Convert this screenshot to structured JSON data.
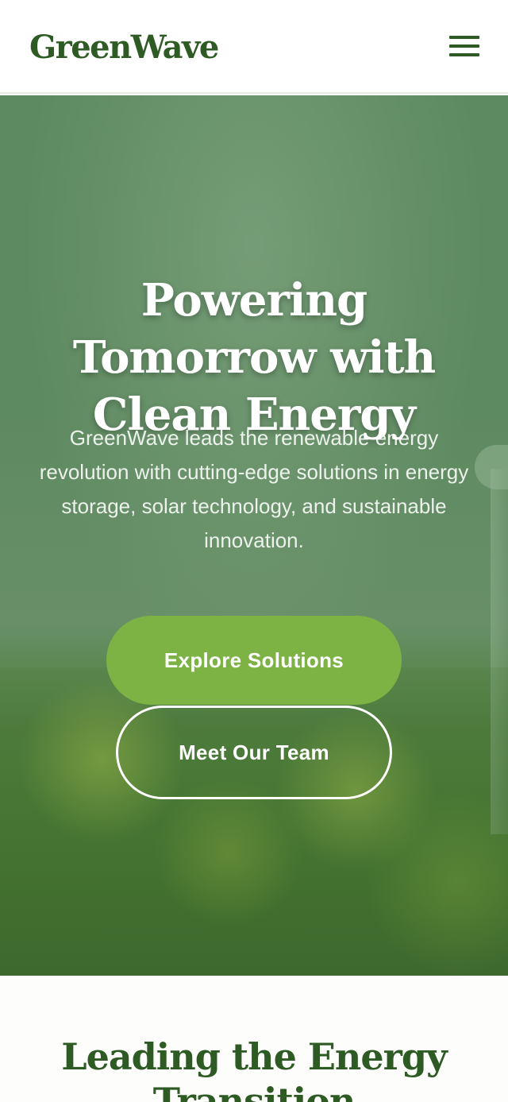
{
  "header": {
    "logo": "GreenWave",
    "menu_icon": "hamburger-menu-icon"
  },
  "hero": {
    "title": "Powering Tomorrow with Clean Energy",
    "description": "GreenWave leads the renewable energy revolution with cutting-edge solutions in energy storage, solar technology, and sustainable innovation.",
    "primary_button": "Explore Solutions",
    "secondary_button": "Meet Our Team"
  },
  "section": {
    "title": "Leading the Energy Transition"
  },
  "colors": {
    "brand": "#2e5a23",
    "accent": "#7db244",
    "hero_overlay": "#5d8a5f"
  }
}
